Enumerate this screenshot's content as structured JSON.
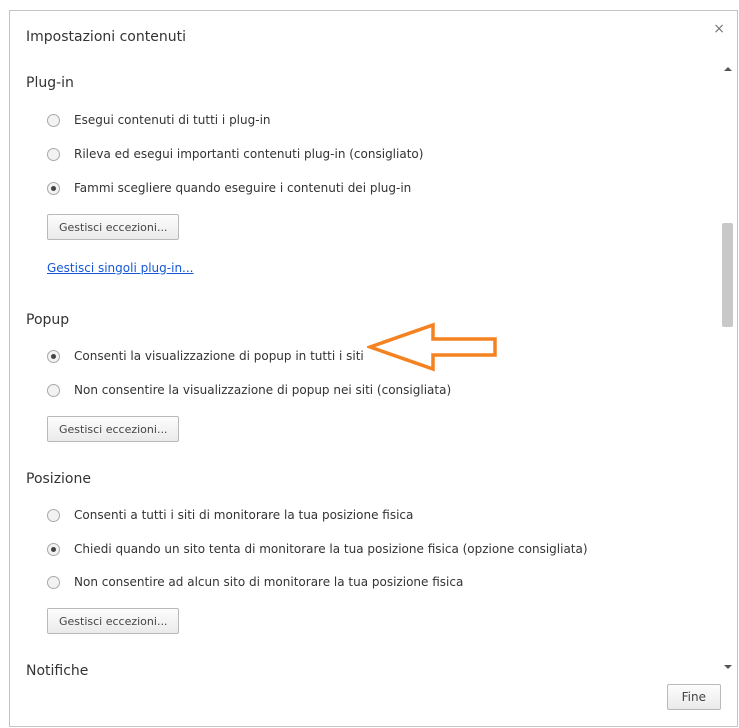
{
  "dialog": {
    "title": "Impostazioni contenuti",
    "close_symbol": "×",
    "done_label": "Fine"
  },
  "sections": {
    "plugin": {
      "heading": "Plug-in",
      "options": [
        {
          "label": "Esegui contenuti di tutti i plug-in",
          "checked": false
        },
        {
          "label": "Rileva ed esegui importanti contenuti plug-in (consigliato)",
          "checked": false
        },
        {
          "label": "Fammi scegliere quando eseguire i contenuti dei plug-in",
          "checked": true
        }
      ],
      "button_label": "Gestisci eccezioni...",
      "link_label": "Gestisci singoli plug-in..."
    },
    "popup": {
      "heading": "Popup",
      "options": [
        {
          "label": "Consenti la visualizzazione di popup in tutti i siti",
          "checked": true
        },
        {
          "label": "Non consentire la visualizzazione di popup nei siti (consigliata)",
          "checked": false
        }
      ],
      "button_label": "Gestisci eccezioni..."
    },
    "posizione": {
      "heading": "Posizione",
      "options": [
        {
          "label": "Consenti a tutti i siti di monitorare la tua posizione fisica",
          "checked": false
        },
        {
          "label": "Chiedi quando un sito tenta di monitorare la tua posizione fisica (opzione consigliata)",
          "checked": true
        },
        {
          "label": "Non consentire ad alcun sito di monitorare la tua posizione fisica",
          "checked": false
        }
      ],
      "button_label": "Gestisci eccezioni..."
    },
    "notifiche": {
      "heading": "Notifiche"
    }
  },
  "annotation": {
    "arrow_color": "#f58220"
  }
}
